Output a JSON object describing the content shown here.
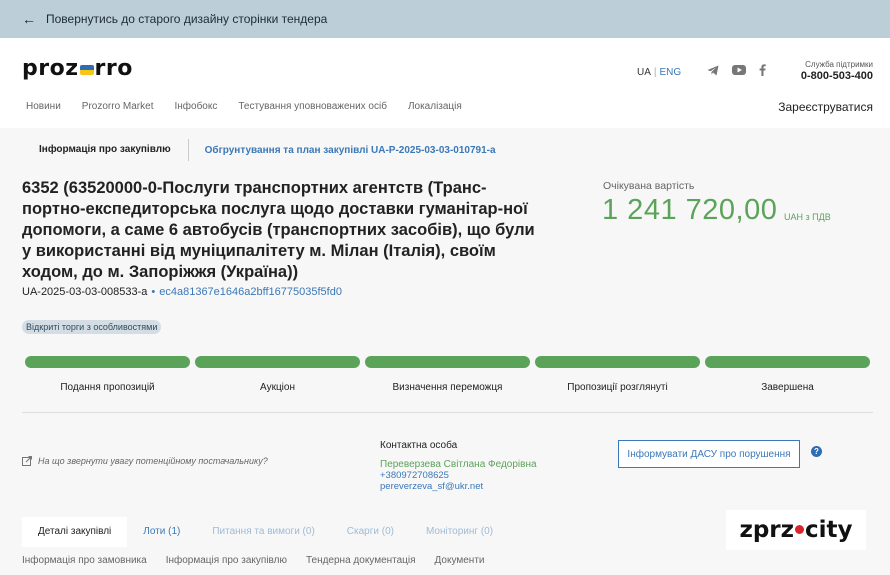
{
  "topbar": {
    "back_text": "Повернутись до старого дизайну сторінки тендера"
  },
  "header": {
    "logo_left": "proz",
    "logo_right": "rro",
    "lang_ua": "UA",
    "lang_eng": "ENG",
    "support_label": "Служба підтримки",
    "support_phone": "0-800-503-400",
    "register": "Зареєструватися",
    "nav": [
      "Новини",
      "Prozorro Market",
      "Інфобокс",
      "Тестування уповноважених осіб",
      "Локалізація"
    ]
  },
  "subtabs": {
    "active": "Інформація про закупівлю",
    "link": "Обгрунтування та план закупівлі UA-P-2025-03-03-010791-a"
  },
  "tender": {
    "title": "6352 (63520000-0-Послуги транспортних агентств (Транс-портно-експедиторська послуга щодо доставки гуманітар-ної допомоги, а саме 6 автобусів (транспортних засобів), що були у використанні від муніципалітету м. Мілан (Італія), своїм ходом, до м. Запоріжжя (Україна))",
    "id": "UA-2025-03-03-008533-a",
    "hash": "ec4a81367e1646a2bff16775035f5fd0",
    "badge": "Відкриті торги з особливостями",
    "value_label": "Очікувана вартість",
    "value_amount": "1 241 720,00",
    "value_unit": "UAH з ПДВ"
  },
  "stages": [
    {
      "label": "Подання пропозицій",
      "progress": 1
    },
    {
      "label": "Аукціон",
      "progress": 1
    },
    {
      "label": "Визначення переможця",
      "progress": 1
    },
    {
      "label": "Пропозиції розглянуті",
      "progress": 1
    },
    {
      "label": "Завершена",
      "progress": 1
    }
  ],
  "hint": "На що звернути увагу потенційному постачальнику?",
  "contact": {
    "title": "Контактна особа",
    "name": "Переверзева Світлана Федорівна",
    "phone": "+380972708625",
    "email": "pereverzeva_sf@ukr.net"
  },
  "report_button": "Інформувати ДАСУ про порушення",
  "help_mark": "?",
  "main_tabs": [
    {
      "label": "Деталі закупівлі",
      "state": "active"
    },
    {
      "label": "Лоти (1)",
      "state": "link"
    },
    {
      "label": "Питання та вимоги (0)",
      "state": "muted"
    },
    {
      "label": "Скарги (0)",
      "state": "muted"
    },
    {
      "label": "Моніторинг (0)",
      "state": "muted"
    }
  ],
  "bottom_links": [
    "Інформація про замовника",
    "Інформація про закупівлю",
    "Тендерна документація",
    "Документи"
  ],
  "watermark": {
    "left": "zprz",
    "right": "city"
  },
  "colors": {
    "accent_green": "#5ca35a",
    "link_blue": "#3b78b8",
    "topbar_bg": "#bccfd9",
    "flag_blue": "#2f6db0",
    "flag_yellow": "#f5c518",
    "watermark_red": "#d9262b"
  },
  "icons": {
    "back": "arrow-left-icon",
    "telegram": "telegram-icon",
    "youtube": "youtube-icon",
    "facebook": "facebook-icon",
    "hint": "external-link-icon",
    "help": "question-icon"
  }
}
